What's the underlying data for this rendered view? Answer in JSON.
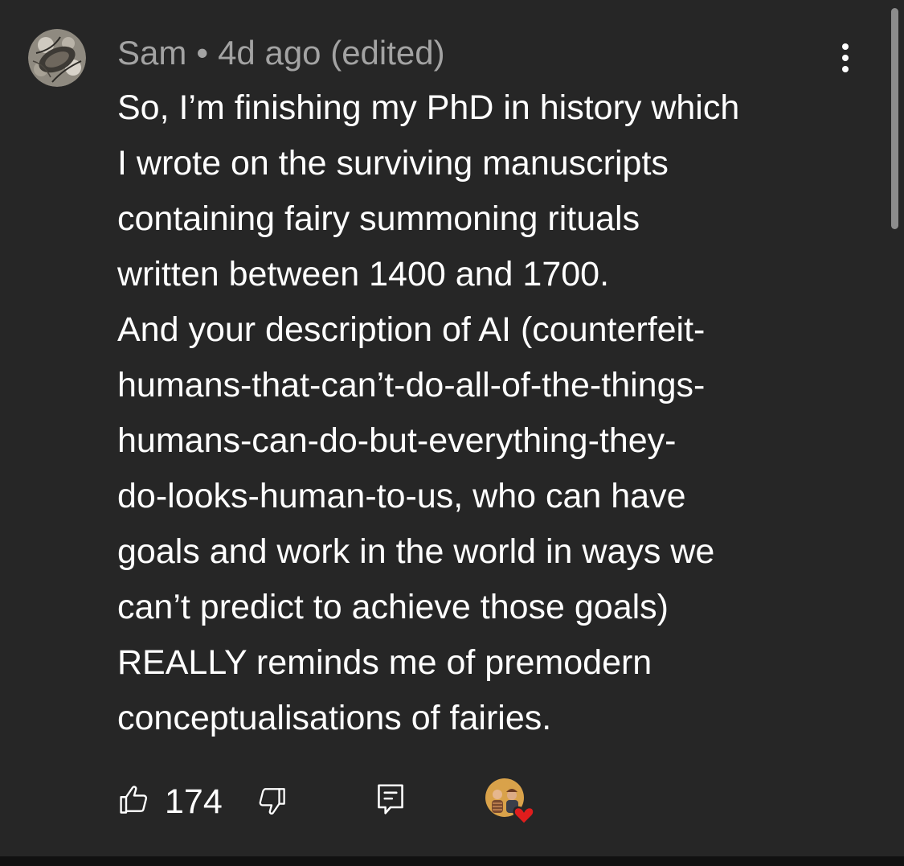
{
  "comment": {
    "author": "Sam",
    "separator": "•",
    "timestamp": "4d ago (edited)",
    "lines": [
      "So, I’m finishing my PhD in history which",
      "I wrote on the surviving manuscripts",
      "containing fairy summoning rituals",
      "written between 1400 and 1700.",
      "And your description of AI (counterfeit-",
      "humans-that-can’t-do-all-of-the-things-",
      "humans-can-do-but-everything-they-",
      "do-looks-human-to-us, who can have",
      "goals and work in the world in ways we",
      "can’t predict to achieve those goals)",
      "REALLY reminds me of premodern",
      "conceptualisations of fairies."
    ]
  },
  "actions": {
    "like_count": "174",
    "icons": {
      "like": "thumbs-up-icon",
      "dislike": "thumbs-down-icon",
      "reply": "reply-comment-icon",
      "creator_heart": "creator-heart-icon",
      "more": "more-options-icon"
    }
  },
  "colors": {
    "background": "#262626",
    "text": "#ffffff",
    "meta_text": "#a3a3a3",
    "heart": "#e01d1d"
  }
}
